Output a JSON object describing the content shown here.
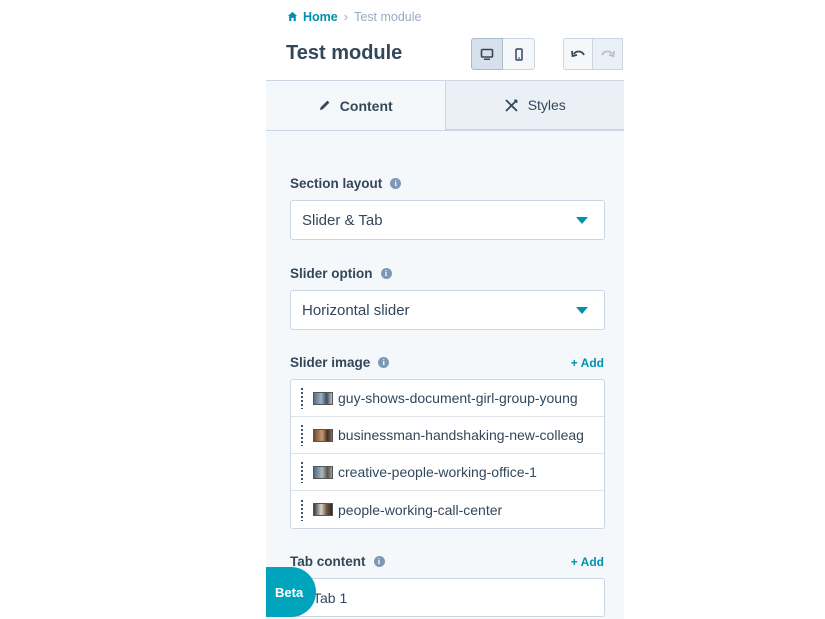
{
  "breadcrumb": {
    "home": "Home",
    "separator": "›",
    "current": "Test module"
  },
  "title": "Test module",
  "tabs": [
    {
      "label": "Content",
      "icon": "pencil-icon"
    },
    {
      "label": "Styles",
      "icon": "styles-icon"
    }
  ],
  "section_layout": {
    "label": "Section layout",
    "value": "Slider & Tab"
  },
  "slider_option": {
    "label": "Slider option",
    "value": "Horizontal slider"
  },
  "slider_image": {
    "label": "Slider image",
    "add": "+ Add",
    "items": [
      "guy-shows-document-girl-group-young",
      "businessman-handshaking-new-colleag",
      "creative-people-working-office-1",
      "people-working-call-center"
    ]
  },
  "tab_content": {
    "label": "Tab content",
    "add": "+ Add",
    "items": [
      "Tab 1"
    ]
  },
  "beta": "Beta",
  "colors": {
    "accent": "#0091ae",
    "beta": "#00a4bd",
    "text": "#33475b"
  }
}
